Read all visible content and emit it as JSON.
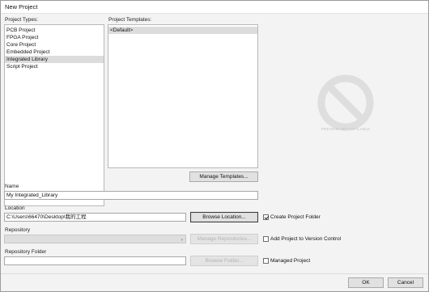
{
  "window": {
    "title": "New Project"
  },
  "project_types": {
    "label": "Project Types:",
    "items": [
      {
        "label": "PCB Project",
        "selected": false
      },
      {
        "label": "FPGA Project",
        "selected": false
      },
      {
        "label": "Core Project",
        "selected": false
      },
      {
        "label": "Embedded Project",
        "selected": false
      },
      {
        "label": "Integrated Library",
        "selected": true
      },
      {
        "label": "Script Project",
        "selected": false
      }
    ]
  },
  "project_templates": {
    "label": "Project Templates:",
    "items": [
      {
        "label": "<Default>",
        "selected": true
      }
    ],
    "manage_label": "Manage Templates..."
  },
  "preview": {
    "caption": "PREVIEW NOT AVAILABLE"
  },
  "name": {
    "label": "Name",
    "value": "My Integrated_Library"
  },
  "location": {
    "label": "Location",
    "value": "C:\\Users\\66470\\Desktop\\我的工程",
    "browse_label": "Browse Location...",
    "create_folder_label": "Create Project Folder",
    "create_folder_checked": true
  },
  "repository": {
    "label": "Repository",
    "value": "",
    "manage_label": "Manage Repositories...",
    "add_vc_label": "Add Project to Version Control",
    "add_vc_checked": false
  },
  "repository_folder": {
    "label": "Repository Folder",
    "value": "",
    "browse_label": "Browse Folder...",
    "managed_label": "Managed Project",
    "managed_checked": false
  },
  "footer": {
    "ok_label": "OK",
    "cancel_label": "Cancel"
  }
}
